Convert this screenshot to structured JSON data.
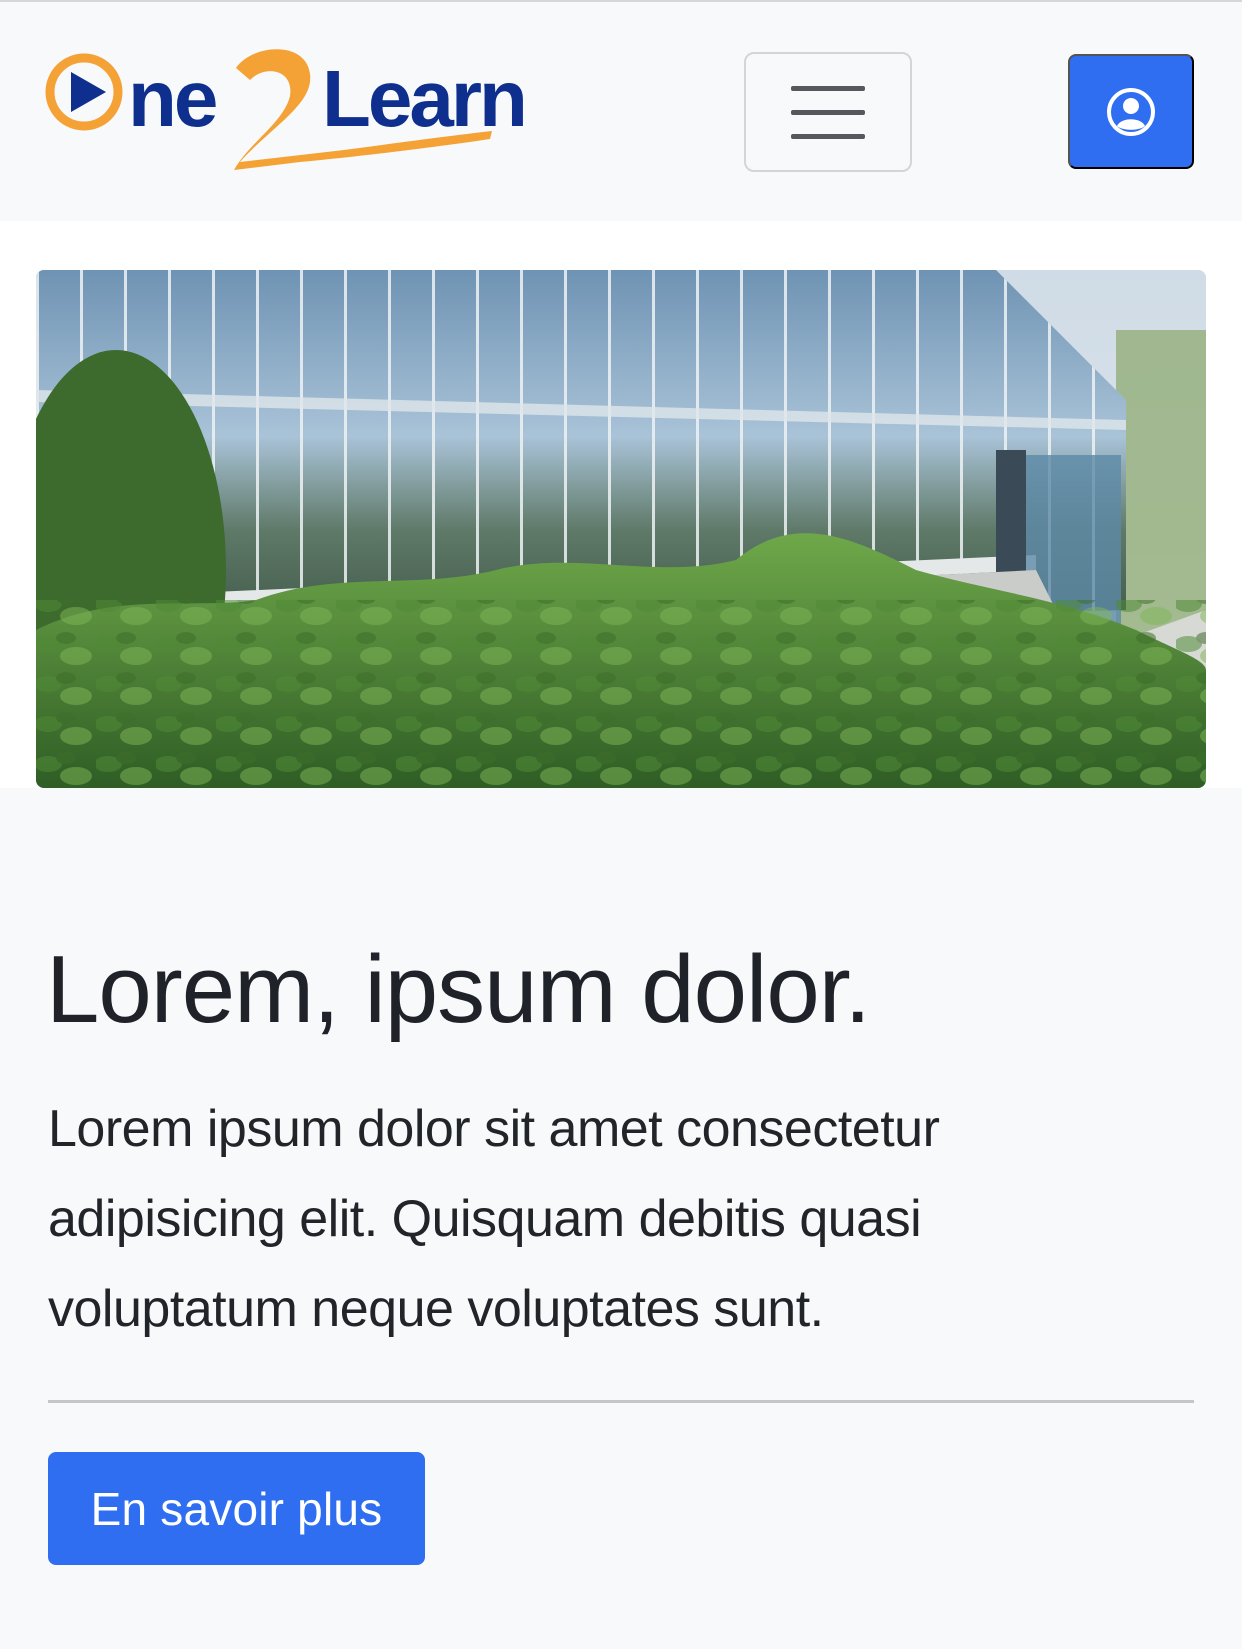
{
  "navbar": {
    "brand": {
      "logo_text_prefix": "ne",
      "logo_text_number": "2",
      "logo_text_suffix": "Learn",
      "logo_alt": "One2Learn"
    },
    "menu_icon": "hamburger-menu-icon",
    "account_icon": "user-circle-icon"
  },
  "hero": {
    "image_description": "glass-office-building-with-trees"
  },
  "content": {
    "title": "Lorem, ipsum dolor.",
    "lead": "Lorem ipsum dolor sit amet consectetur adipisicing elit. Quisquam debitis quasi voluptatum neque voluptates sunt.",
    "cta_label": "En savoir plus"
  },
  "colors": {
    "primary": "#2f6ef1",
    "logo_blue": "#0f2f8f",
    "logo_orange": "#f4a236",
    "background": "#f8f9fa",
    "text": "#212529"
  }
}
